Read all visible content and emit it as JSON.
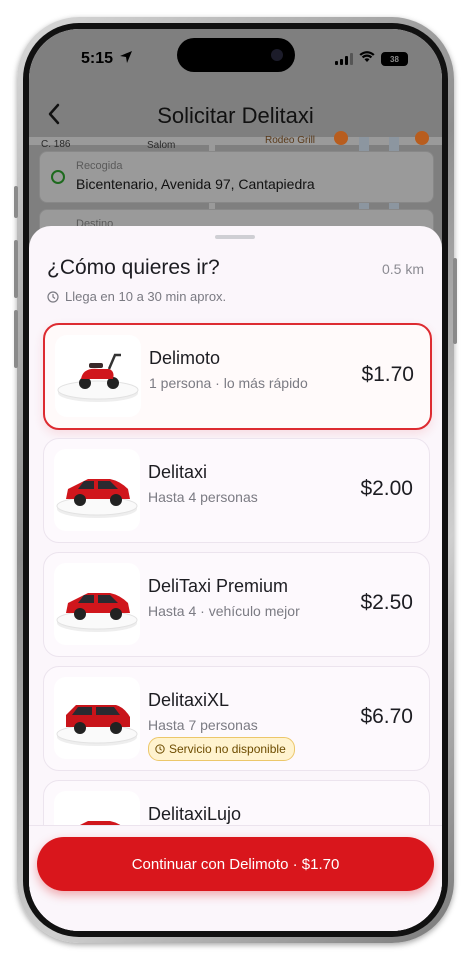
{
  "status_bar": {
    "time": "5:15",
    "battery": "38"
  },
  "header": {
    "back_icon": "chevron-left-icon",
    "title": "Solicitar Delitaxi"
  },
  "map": {
    "street_labels": [
      "C. 186",
      "Salom",
      "Rodeo Grill"
    ]
  },
  "pickup": {
    "label": "Recogida",
    "value": "Bicentenario, Avenida 97, Cantapiedra"
  },
  "destination": {
    "label": "Destino"
  },
  "sheet": {
    "question": "¿Cómo quieres ir?",
    "distance": "0.5 km",
    "eta": "Llega en 10 a 30 min aprox."
  },
  "options": [
    {
      "name": "Delimoto",
      "subtitle": "1 persona · lo más rápido",
      "price": "$1.70",
      "selected": true,
      "vehicle": "scooter-icon"
    },
    {
      "name": "Delitaxi",
      "subtitle": "Hasta 4 personas",
      "price": "$2.00",
      "selected": false,
      "vehicle": "car-icon"
    },
    {
      "name": "DeliTaxi Premium",
      "subtitle": "Hasta 4 · vehículo mejor",
      "price": "$2.50",
      "selected": false,
      "vehicle": "car-icon"
    },
    {
      "name": "DelitaxiXL",
      "subtitle": "Hasta 7 personas",
      "price": "$6.70",
      "selected": false,
      "vehicle": "suv-icon",
      "badge": "Servicio no disponible"
    },
    {
      "name": "DelitaxiLujo",
      "subtitle": "",
      "price": "",
      "selected": false,
      "vehicle": "car-icon"
    }
  ],
  "footer": {
    "cta_label": "Continuar con Delimoto · $1.70"
  },
  "colors": {
    "accent": "#d9161c",
    "selected_border": "#dd2b31",
    "badge_bg": "#fff3cf"
  }
}
